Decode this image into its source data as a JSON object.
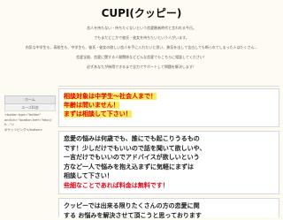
{
  "header": {
    "title": "CUPI(クッピー)"
  },
  "intro": {
    "lines": [
      "恋人を持たない・持ちたくないという恋愛観者時代と言われる今日。",
      "でもまだどこかで彼氏・彼女を持ちたいという人がいます。",
      "内気な中学生も、高校生も、中学生も、彼氏・彼女の欲しい恋人を手に入れたいと思い、勇気を出して告白しても断られてしまった人はたくさん...",
      "恋愛全般、恋愛に関する人間関係などどんな恋愛でもこちらに相談してください！",
      "必ずあなたが納得できるまで全力でサポートして問題を解決します！"
    ]
  },
  "sidebar": {
    "header": "ホーム",
    "sub": "ユーズ料金",
    "code": "<button type=\"button\"\nonclick=\"location.href='http://h...'\">\nポケッツピング</button>"
  },
  "notice": {
    "line1": "相談対象は中学生～社会人まで！",
    "line2": "年齢は問いません！",
    "line3": "まずは相談して下さい！"
  },
  "message": {
    "lines": [
      "恋愛の悩みは何歳でも、誰にでも起こりうるもの",
      "です！少しだけでもいいので話を聞いて欲しいや、",
      "一言だけでもいいのでアドバイスが欲しいという",
      "方など一人で悩みを抱え込まずに気軽にまずは",
      "相談して下さい！"
    ],
    "red_line": "些細なことであれば料金は無料です！"
  },
  "footer_box": {
    "lines": [
      "クッピーでは出来る限りたくさんの方の恋愛に関",
      "する お悩みを解決させて頂こうと思っております"
    ]
  }
}
